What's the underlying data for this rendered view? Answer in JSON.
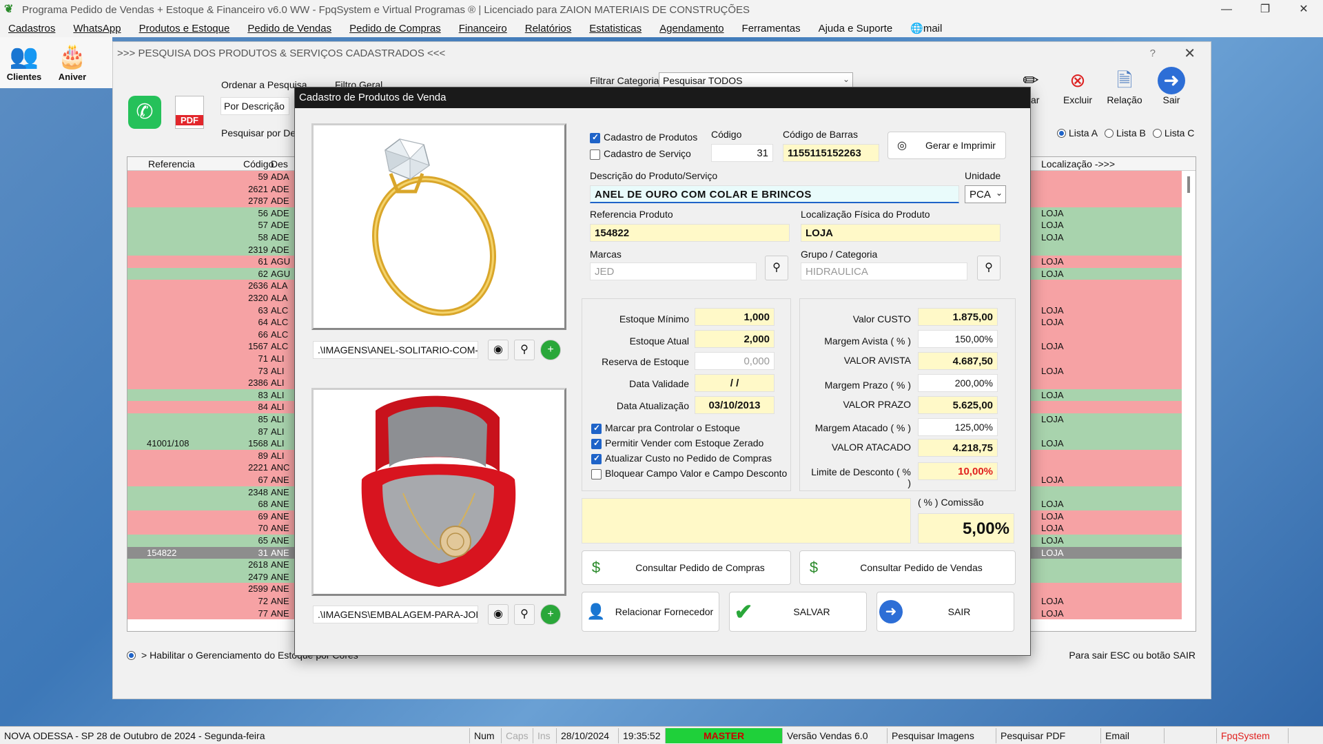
{
  "app": {
    "title": "Programa Pedido de Vendas + Estoque & Financeiro v6.0 WW - FpqSystem e Virtual Programas ® | Licenciado para  ZAION MATERIAIS DE CONSTRUÇÕES",
    "win_min": "—",
    "win_max": "❐",
    "win_close": "✕"
  },
  "menu": [
    "Cadastros",
    "WhatsApp",
    "Produtos e Estoque",
    "Pedido de Vendas",
    "Pedido de Compras",
    "Financeiro",
    "Relatórios",
    "Estatisticas",
    "Agendamento",
    "Ferramentas",
    "Ajuda e Suporte",
    "mail"
  ],
  "toolbar": {
    "clientes": "Clientes",
    "aniver": "Aniver"
  },
  "search_window": {
    "title": ">>>  PESQUISA DOS PRODUTOS & SERVIÇOS CADASTRADOS  <<<",
    "help": "?",
    "close": "✕",
    "pdf_label": "PDF",
    "order_label": "Ordenar a Pesquisa",
    "order_value": "Por Descrição",
    "filter_label": "Filtro Geral",
    "search_by_label": "Pesquisar por Des",
    "category_label": "Filtrar Categoria",
    "category_value": "Pesquisar TODOS",
    "buttons": {
      "alterar": "erar",
      "excluir": "Excluir",
      "relacao": "Relação",
      "sair": "Sair"
    },
    "lists": [
      "Lista A",
      "Lista B",
      "Lista C"
    ],
    "grid_headers": {
      "ref": "Referencia",
      "cod": "Código",
      "des": "Des",
      "loc": "Localização ->>>"
    },
    "rows": [
      {
        "ref": "",
        "cod": "59",
        "des": "ADA",
        "loc": "",
        "c": "red"
      },
      {
        "ref": "",
        "cod": "2621",
        "des": "ADE",
        "loc": "",
        "c": "red"
      },
      {
        "ref": "",
        "cod": "2787",
        "des": "ADE",
        "loc": "",
        "c": "red"
      },
      {
        "ref": "",
        "cod": "56",
        "des": "ADE",
        "loc": "LOJA",
        "c": "green"
      },
      {
        "ref": "",
        "cod": "57",
        "des": "ADE",
        "loc": "LOJA",
        "c": "green"
      },
      {
        "ref": "",
        "cod": "58",
        "des": "ADE",
        "loc": "LOJA",
        "c": "green"
      },
      {
        "ref": "",
        "cod": "2319",
        "des": "ADE",
        "loc": "",
        "c": "green"
      },
      {
        "ref": "",
        "cod": "61",
        "des": "AGU",
        "loc": "LOJA",
        "c": "red"
      },
      {
        "ref": "",
        "cod": "62",
        "des": "AGU",
        "loc": "LOJA",
        "c": "green"
      },
      {
        "ref": "",
        "cod": "2636",
        "des": "ALA",
        "loc": "",
        "c": "red"
      },
      {
        "ref": "",
        "cod": "2320",
        "des": "ALA",
        "loc": "",
        "c": "red"
      },
      {
        "ref": "",
        "cod": "63",
        "des": "ALC",
        "loc": "LOJA",
        "c": "red"
      },
      {
        "ref": "",
        "cod": "64",
        "des": "ALC",
        "loc": "LOJA",
        "c": "red"
      },
      {
        "ref": "",
        "cod": "66",
        "des": "ALC",
        "loc": "",
        "c": "red"
      },
      {
        "ref": "",
        "cod": "1567",
        "des": "ALC",
        "loc": "LOJA",
        "c": "red"
      },
      {
        "ref": "",
        "cod": "71",
        "des": "ALI",
        "loc": "",
        "c": "red"
      },
      {
        "ref": "",
        "cod": "73",
        "des": "ALI",
        "loc": "LOJA",
        "c": "red"
      },
      {
        "ref": "",
        "cod": "2386",
        "des": "ALI",
        "loc": "",
        "c": "red"
      },
      {
        "ref": "",
        "cod": "83",
        "des": "ALI",
        "loc": "LOJA",
        "c": "green"
      },
      {
        "ref": "",
        "cod": "84",
        "des": "ALI",
        "loc": "",
        "c": "red"
      },
      {
        "ref": "",
        "cod": "85",
        "des": "ALI",
        "loc": "LOJA",
        "c": "green"
      },
      {
        "ref": "",
        "cod": "87",
        "des": "ALI",
        "loc": "",
        "c": "green"
      },
      {
        "ref": "41001/108",
        "cod": "1568",
        "des": "ALI",
        "loc": "LOJA",
        "c": "green"
      },
      {
        "ref": "",
        "cod": "89",
        "des": "ALI",
        "loc": "",
        "c": "red"
      },
      {
        "ref": "",
        "cod": "2221",
        "des": "ANC",
        "loc": "",
        "c": "red"
      },
      {
        "ref": "",
        "cod": "67",
        "des": "ANE",
        "loc": "LOJA",
        "c": "red"
      },
      {
        "ref": "",
        "cod": "2348",
        "des": "ANE",
        "loc": "",
        "c": "green"
      },
      {
        "ref": "",
        "cod": "68",
        "des": "ANE",
        "loc": "LOJA",
        "c": "green"
      },
      {
        "ref": "",
        "cod": "69",
        "des": "ANE",
        "loc": "LOJA",
        "c": "red"
      },
      {
        "ref": "",
        "cod": "70",
        "des": "ANE",
        "loc": "LOJA",
        "c": "red"
      },
      {
        "ref": "",
        "cod": "65",
        "des": "ANE",
        "loc": "LOJA",
        "c": "green"
      },
      {
        "ref": "154822",
        "cod": "31",
        "des": "ANE",
        "loc": "LOJA",
        "c": "sel"
      },
      {
        "ref": "",
        "cod": "2618",
        "des": "ANE",
        "loc": "",
        "c": "green"
      },
      {
        "ref": "",
        "cod": "2479",
        "des": "ANE",
        "loc": "",
        "c": "green"
      },
      {
        "ref": "",
        "cod": "2599",
        "des": "ANE",
        "loc": "",
        "c": "red"
      },
      {
        "ref": "",
        "cod": "72",
        "des": "ANE",
        "loc": "LOJA",
        "c": "red"
      },
      {
        "ref": "",
        "cod": "77",
        "des": "ANE",
        "loc": "LOJA",
        "c": "red"
      }
    ],
    "bottom_note": "> Habilitar o Gerenciamento do Estoque por Cores",
    "exit_note": "Para sair ESC ou botão SAIR"
  },
  "modal": {
    "title": "Cadastro de Produtos de Venda",
    "image1_path": ".\\IMAGENS\\ANEL-SOLITARIO-COM-Z",
    "image2_path": ".\\IMAGENS\\EMBALAGEM-PARA-JOIA",
    "chk_produtos": "Cadastro de Produtos",
    "chk_servico": "Cadastro de Serviço",
    "codigo_label": "Código",
    "codigo": "31",
    "barras_label": "Código de Barras",
    "barras": "1155115152263",
    "gerar_btn": "Gerar e Imprimir",
    "descricao_label": "Descrição do Produto/Serviço",
    "descricao": "ANEL DE OURO COM COLAR E BRINCOS",
    "unidade_label": "Unidade",
    "unidade": "PCA",
    "ref_label": "Referencia Produto",
    "ref": "154822",
    "loc_label": "Localização Física do Produto",
    "loc": "LOJA",
    "marcas_label": "Marcas",
    "marcas": "JED",
    "grupo_label": "Grupo / Categoria",
    "grupo": "HIDRAULICA",
    "stock": {
      "min_label": "Estoque Mínimo",
      "min": "1,000",
      "atual_label": "Estoque Atual",
      "atual": "2,000",
      "reserva_label": "Reserva de Estoque",
      "reserva": "0,000",
      "validade_label": "Data Validade",
      "validade": "/  /",
      "atualizacao_label": "Data Atualização",
      "atualizacao": "03/10/2013"
    },
    "options": [
      {
        "label": "Marcar pra Controlar o Estoque",
        "on": true
      },
      {
        "label": "Permitir Vender com Estoque Zerado",
        "on": true
      },
      {
        "label": "Atualizar Custo no Pedido de Compras",
        "on": true
      },
      {
        "label": "Bloquear Campo Valor e Campo Desconto",
        "on": false
      }
    ],
    "prices": {
      "custo_label": "Valor CUSTO",
      "custo": "1.875,00",
      "m_avista_label": "Margem Avista ( % )",
      "m_avista": "150,00%",
      "avista_label": "VALOR AVISTA",
      "avista": "4.687,50",
      "m_prazo_label": "Margem Prazo ( % )",
      "m_prazo": "200,00%",
      "prazo_label": "VALOR PRAZO",
      "prazo": "5.625,00",
      "m_atacado_label": "Margem Atacado ( % )",
      "m_atacado": "125,00%",
      "atacado_label": "VALOR ATACADO",
      "atacado": "4.218,75",
      "desconto_label": "Limite de Desconto ( % )",
      "desconto": "10,00%"
    },
    "comissao_label": "( % ) Comissão",
    "comissao": "5,00%",
    "btn_compras": "Consultar Pedido de Compras",
    "btn_vendas": "Consultar Pedido de Vendas",
    "btn_fornecedor": "Relacionar Fornecedor",
    "btn_salvar": "SALVAR",
    "btn_sair": "SAIR"
  },
  "status": {
    "local": "NOVA ODESSA - SP 28 de Outubro de 2024 - Segunda-feira",
    "num": "Num",
    "caps": "Caps",
    "ins": "Ins",
    "date": "28/10/2024",
    "time": "19:35:52",
    "master": "MASTER",
    "versao": "Versão Vendas 6.0",
    "pesq_img": "Pesquisar Imagens",
    "pesq_pdf": "Pesquisar PDF",
    "email": "Email",
    "brand": "FpqSystem"
  },
  "colors": {
    "accent": "#1e63c8",
    "row_red": "#f6a2a4",
    "row_green": "#a8d3ad",
    "field_yellow": "#fff9c8",
    "master_green": "#1fd03a"
  }
}
